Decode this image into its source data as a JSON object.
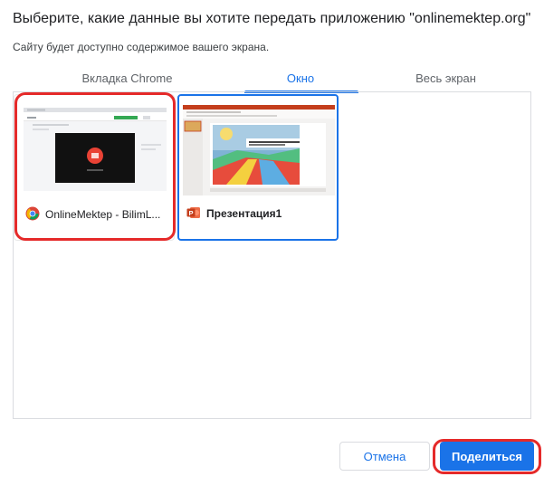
{
  "dialog": {
    "title": "Выберите, какие данные вы хотите передать приложению \"onlinemektep.org\"",
    "subtitle": "Сайту будет доступно содержимое вашего экрана."
  },
  "tabs": [
    {
      "label": "Вкладка Chrome",
      "selected": false
    },
    {
      "label": "Окно",
      "selected": true
    },
    {
      "label": "Весь экран",
      "selected": false
    }
  ],
  "sources": [
    {
      "label": "OnlineMektep - BilimL...",
      "icon": "chrome-icon",
      "selected": false,
      "highlighted": true
    },
    {
      "label": "Презентация1",
      "icon": "powerpoint-icon",
      "selected": true,
      "highlighted": false
    }
  ],
  "buttons": {
    "cancel": "Отмена",
    "share": "Поделиться"
  },
  "colors": {
    "accent": "#1a73e8",
    "highlight": "#e52a2a"
  }
}
